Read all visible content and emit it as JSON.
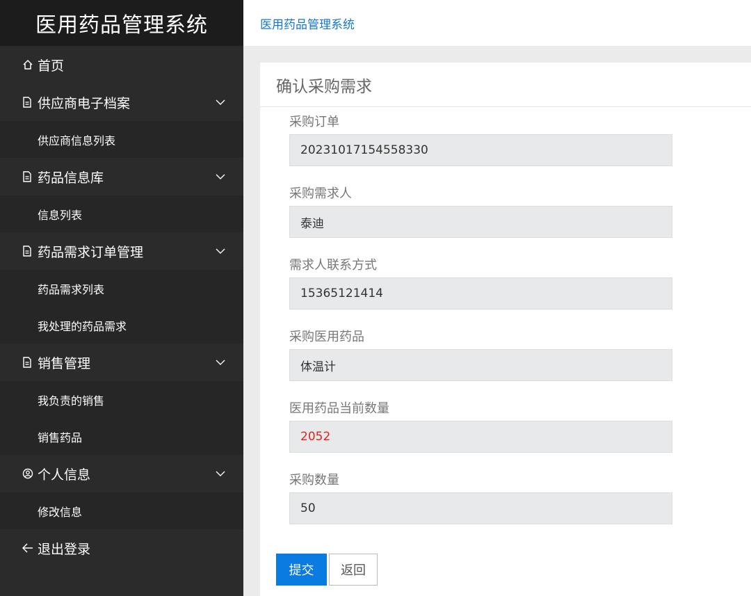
{
  "app": {
    "title": "医用药品管理系统"
  },
  "breadcrumb": "医用药品管理系统",
  "sidebar": {
    "home": {
      "icon": "home-icon",
      "label": "首页"
    },
    "groups": [
      {
        "icon": "document-icon",
        "label": "供应商电子档案",
        "items": [
          "供应商信息列表"
        ]
      },
      {
        "icon": "document-icon",
        "label": "药品信息库",
        "items": [
          "信息列表"
        ]
      },
      {
        "icon": "document-icon",
        "label": "药品需求订单管理",
        "items": [
          "药品需求列表",
          "我处理的药品需求"
        ]
      },
      {
        "icon": "document-icon",
        "label": "销售管理",
        "items": [
          "我负责的销售",
          "销售药品"
        ]
      },
      {
        "icon": "user-circle-icon",
        "label": "个人信息",
        "items": [
          "修改信息"
        ]
      }
    ],
    "logout": {
      "icon": "arrow-left-icon",
      "label": "退出登录"
    }
  },
  "panel": {
    "title": "确认采购需求",
    "fields": [
      {
        "label": "采购订单",
        "value": "20231017154558330"
      },
      {
        "label": "采购需求人",
        "value": "泰迪"
      },
      {
        "label": "需求人联系方式",
        "value": "15365121414"
      },
      {
        "label": "采购医用药品",
        "value": "体温计"
      },
      {
        "label": "医用药品当前数量",
        "value": "2052"
      },
      {
        "label": "采购数量",
        "value": "50"
      }
    ],
    "submit_label": "提交",
    "back_label": "返回"
  },
  "colors": {
    "accent": "#0a7be0",
    "link": "#1677d2",
    "warning_value": "#e0241b",
    "sidebar_bg": "#2b2b2b"
  }
}
